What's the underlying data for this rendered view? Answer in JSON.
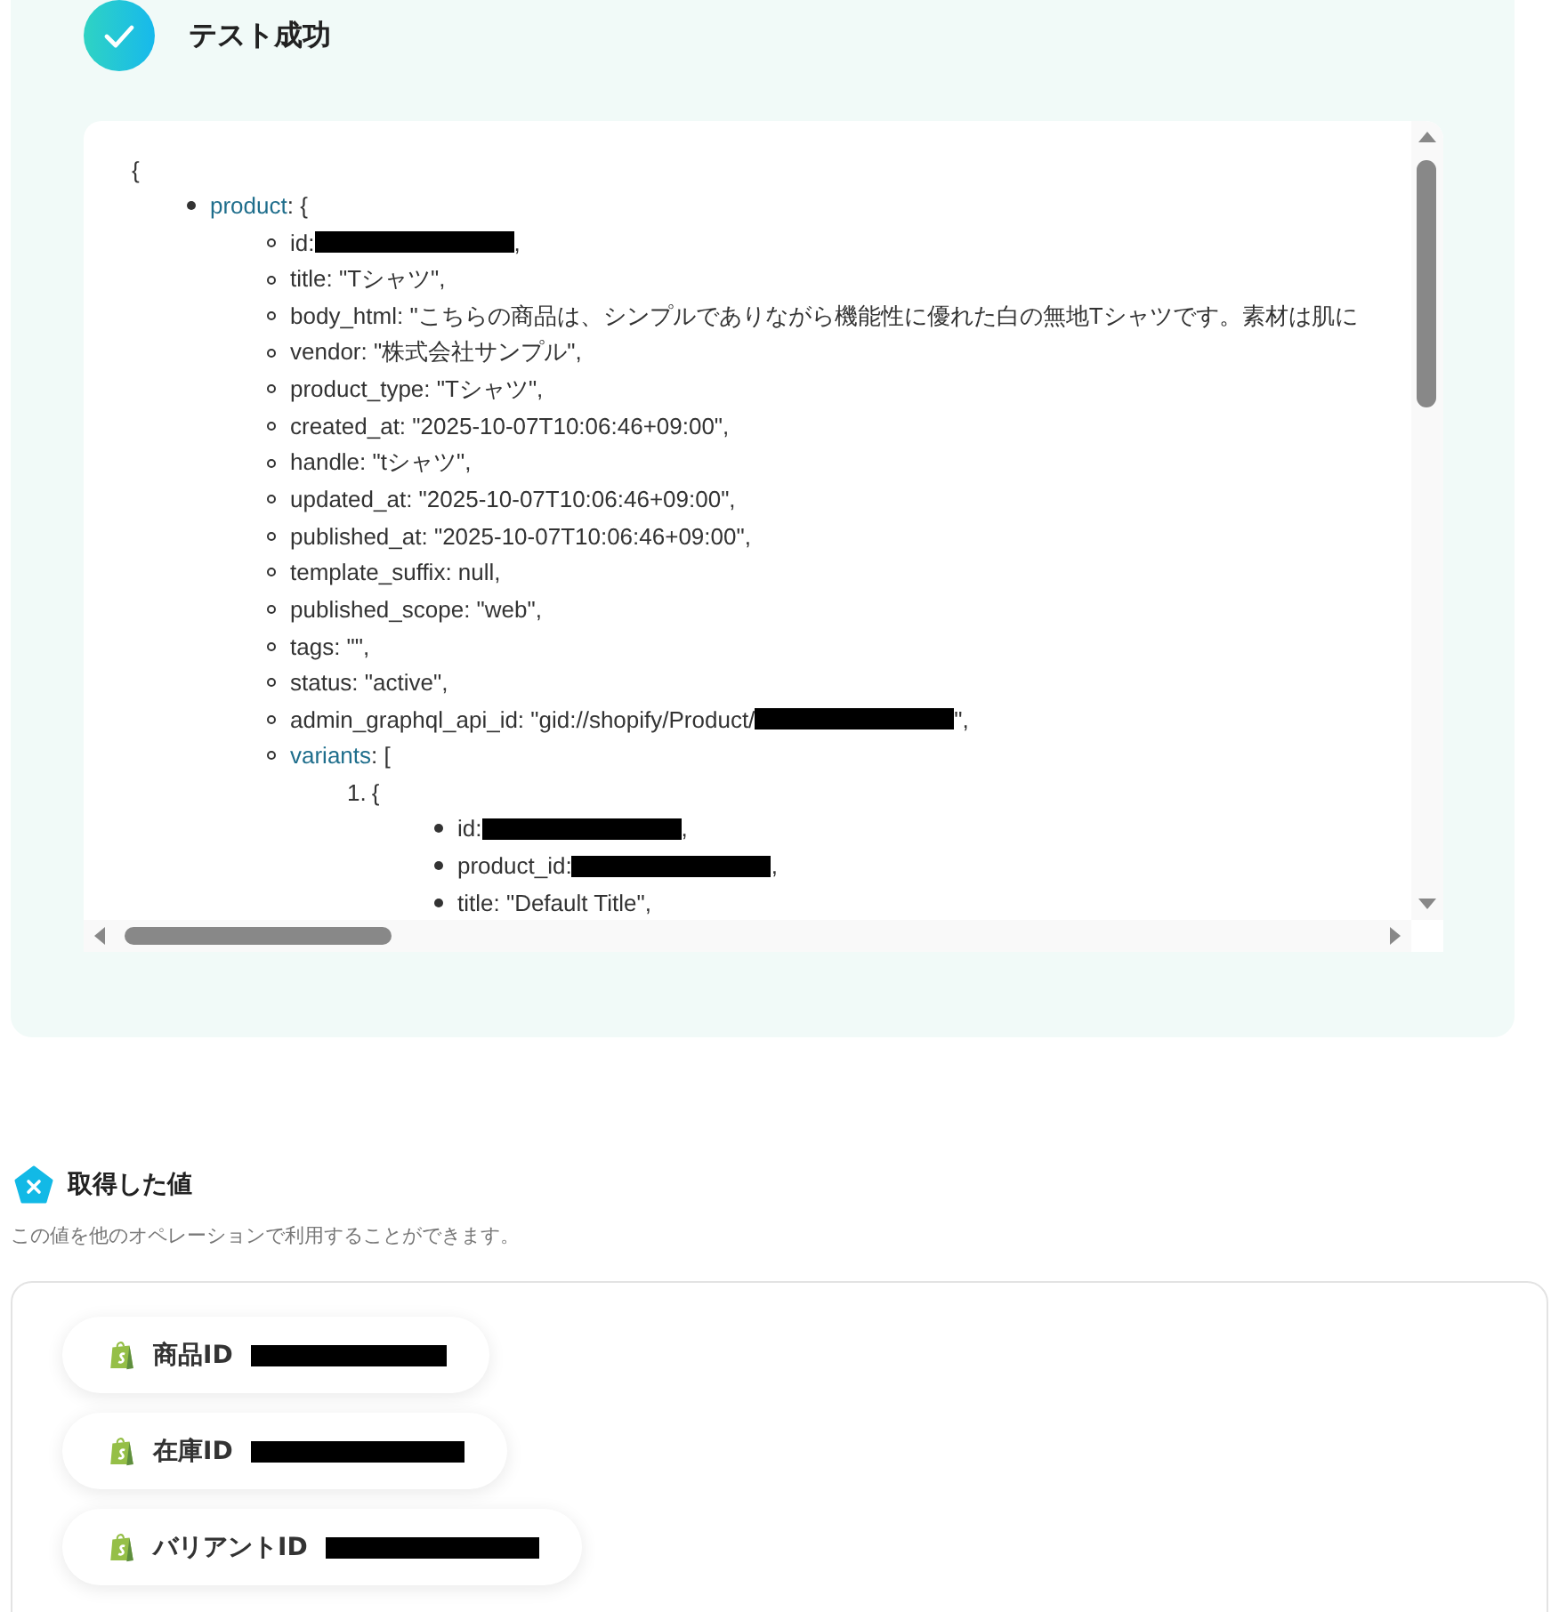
{
  "result": {
    "title": "テスト成功",
    "code": {
      "open": "{",
      "items": [
        {
          "kind": "object",
          "key": "product",
          "text": ": {",
          "children": [
            {
              "kind": "value",
              "text": "id: ",
              "redacted": true,
              "after": ","
            },
            {
              "kind": "value",
              "text": "title: \"Tシャツ\","
            },
            {
              "kind": "value",
              "text": "body_html: \"こちらの商品は、シンプルでありながら機能性に優れた白の無地Tシャツです。素材は肌に"
            },
            {
              "kind": "value",
              "text": "vendor: \"株式会社サンプル\","
            },
            {
              "kind": "value",
              "text": "product_type: \"Tシャツ\","
            },
            {
              "kind": "value",
              "text": "created_at: \"2025-10-07T10:06:46+09:00\","
            },
            {
              "kind": "value",
              "text": "handle: \"tシャツ\","
            },
            {
              "kind": "value",
              "text": "updated_at: \"2025-10-07T10:06:46+09:00\","
            },
            {
              "kind": "value",
              "text": "published_at: \"2025-10-07T10:06:46+09:00\","
            },
            {
              "kind": "value",
              "text": "template_suffix: null,"
            },
            {
              "kind": "value",
              "text": "published_scope: \"web\","
            },
            {
              "kind": "value",
              "text": "tags: \"\","
            },
            {
              "kind": "value",
              "text": "status: \"active\","
            },
            {
              "kind": "value",
              "text": "admin_graphql_api_id: \"gid://shopify/Product/",
              "redacted": true,
              "after": "\","
            },
            {
              "kind": "object",
              "key": "variants",
              "text": ": [",
              "children": [
                {
                  "kind": "ordered",
                  "marker": "1.",
                  "text": "{",
                  "children": [
                    {
                      "kind": "value",
                      "text": "id: ",
                      "redacted": true,
                      "after": ","
                    },
                    {
                      "kind": "value",
                      "text": "product_id: ",
                      "redacted": true,
                      "after": ","
                    },
                    {
                      "kind": "value",
                      "text": "title: \"Default Title\","
                    }
                  ]
                }
              ]
            }
          ]
        }
      ]
    }
  },
  "values": {
    "title": "取得した値",
    "description": "この値を他のオペレーションで利用することができます。",
    "items": [
      {
        "label": "商品ID",
        "redacted": true
      },
      {
        "label": "在庫ID",
        "redacted": true
      },
      {
        "label": "バリアントID",
        "redacted": true
      }
    ]
  }
}
